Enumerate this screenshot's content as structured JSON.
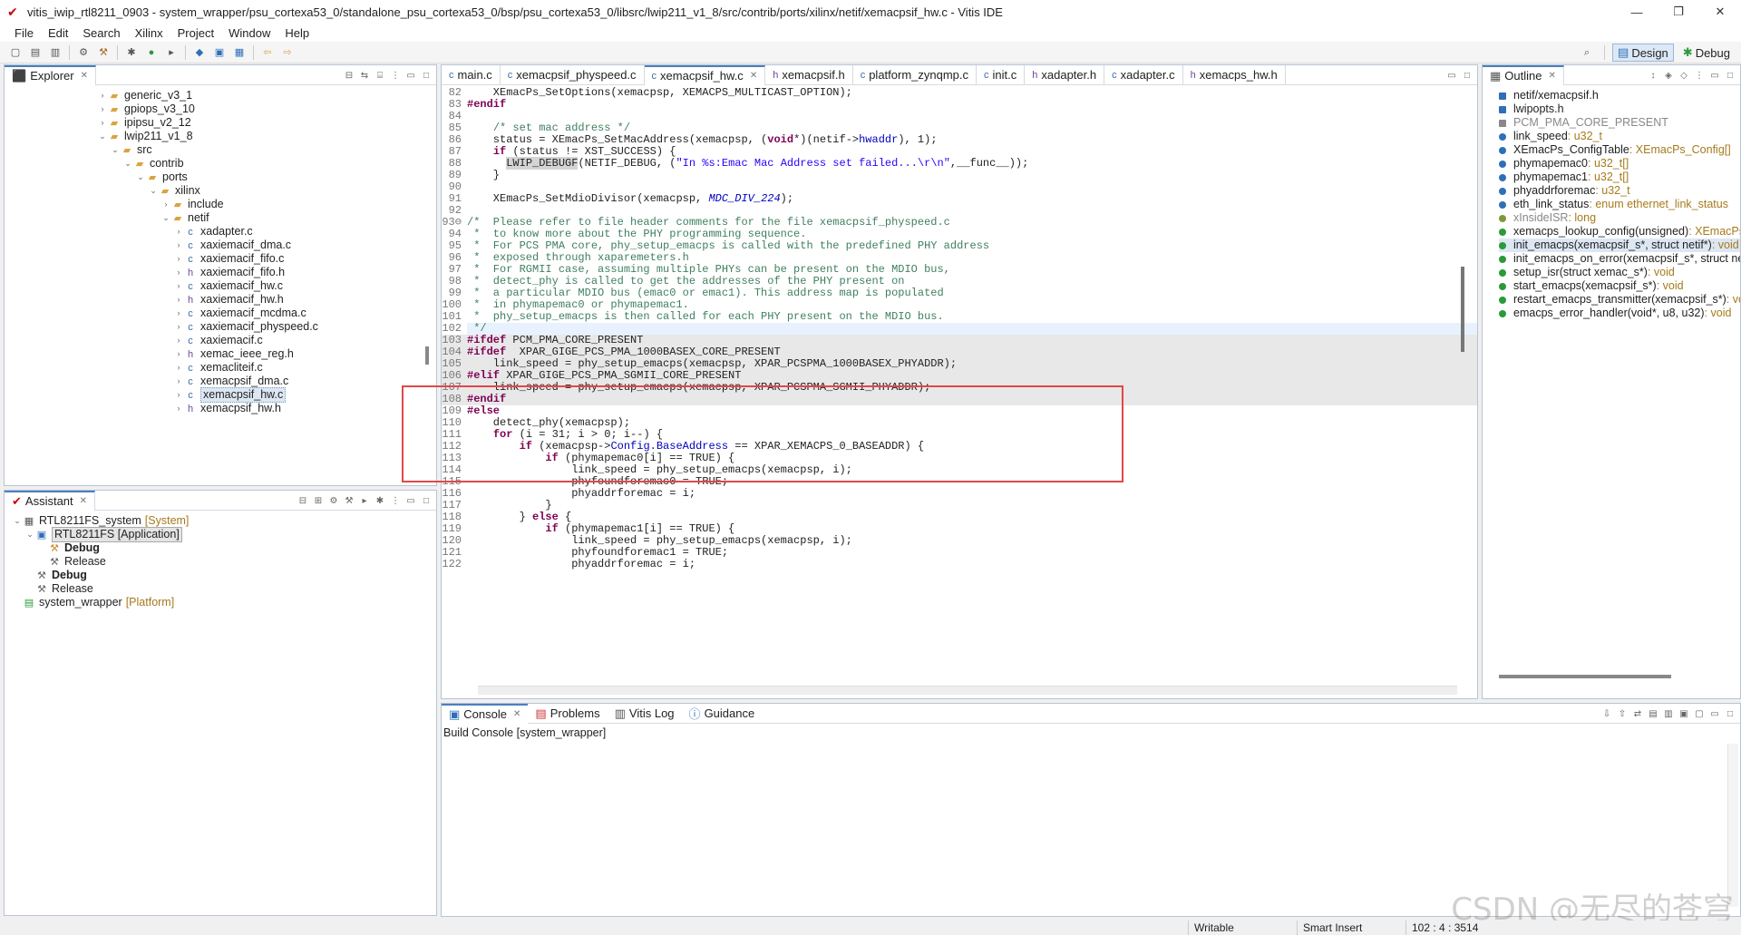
{
  "window": {
    "title": "vitis_iwip_rtl8211_0903 - system_wrapper/psu_cortexa53_0/standalone_psu_cortexa53_0/bsp/psu_cortexa53_0/libsrc/lwip211_v1_8/src/contrib/ports/xilinx/netif/xemacpsif_hw.c - Vitis IDE",
    "minimize": "—",
    "restore": "❐",
    "close": "✕"
  },
  "menu": [
    "File",
    "Edit",
    "Search",
    "Xilinx",
    "Project",
    "Window",
    "Help"
  ],
  "perspectives": {
    "design": "Design",
    "debug": "Debug"
  },
  "explorer": {
    "tab": "Explorer",
    "items": [
      {
        "indent": 0,
        "tw": "›",
        "icon": "folder",
        "label": "generic_v3_1"
      },
      {
        "indent": 0,
        "tw": "›",
        "icon": "folder",
        "label": "gpiops_v3_10"
      },
      {
        "indent": 0,
        "tw": "›",
        "icon": "folder",
        "label": "ipipsu_v2_12"
      },
      {
        "indent": 0,
        "tw": "⌄",
        "icon": "folder",
        "label": "lwip211_v1_8"
      },
      {
        "indent": 1,
        "tw": "⌄",
        "icon": "folder",
        "label": "src"
      },
      {
        "indent": 2,
        "tw": "⌄",
        "icon": "folder",
        "label": "contrib"
      },
      {
        "indent": 3,
        "tw": "⌄",
        "icon": "folder",
        "label": "ports"
      },
      {
        "indent": 4,
        "tw": "⌄",
        "icon": "folder",
        "label": "xilinx"
      },
      {
        "indent": 5,
        "tw": "›",
        "icon": "folder",
        "label": "include"
      },
      {
        "indent": 5,
        "tw": "⌄",
        "icon": "folder",
        "label": "netif"
      },
      {
        "indent": 6,
        "tw": "›",
        "icon": "c",
        "label": "xadapter.c"
      },
      {
        "indent": 6,
        "tw": "›",
        "icon": "c",
        "label": "xaxiemacif_dma.c"
      },
      {
        "indent": 6,
        "tw": "›",
        "icon": "c",
        "label": "xaxiemacif_fifo.c"
      },
      {
        "indent": 6,
        "tw": "›",
        "icon": "h",
        "label": "xaxiemacif_fifo.h"
      },
      {
        "indent": 6,
        "tw": "›",
        "icon": "c",
        "label": "xaxiemacif_hw.c"
      },
      {
        "indent": 6,
        "tw": "›",
        "icon": "h",
        "label": "xaxiemacif_hw.h"
      },
      {
        "indent": 6,
        "tw": "›",
        "icon": "c",
        "label": "xaxiemacif_mcdma.c"
      },
      {
        "indent": 6,
        "tw": "›",
        "icon": "c",
        "label": "xaxiemacif_physpeed.c"
      },
      {
        "indent": 6,
        "tw": "›",
        "icon": "c",
        "label": "xaxiemacif.c"
      },
      {
        "indent": 6,
        "tw": "›",
        "icon": "h",
        "label": "xemac_ieee_reg.h"
      },
      {
        "indent": 6,
        "tw": "›",
        "icon": "c",
        "label": "xemacliteif.c"
      },
      {
        "indent": 6,
        "tw": "›",
        "icon": "c",
        "label": "xemacpsif_dma.c"
      },
      {
        "indent": 6,
        "tw": "›",
        "icon": "c",
        "label": "xemacpsif_hw.c",
        "selected": true
      },
      {
        "indent": 6,
        "tw": "›",
        "icon": "h",
        "label": "xemacpsif_hw.h"
      }
    ]
  },
  "assistant": {
    "tab": "Assistant",
    "items": [
      {
        "indent": 0,
        "tw": "⌄",
        "label": "RTL8211FS_system",
        "tag": "[System]",
        "icon": "sys"
      },
      {
        "indent": 1,
        "tw": "⌄",
        "label": "RTL8211FS [Application]",
        "tag": "",
        "icon": "app",
        "boxed": true
      },
      {
        "indent": 2,
        "tw": "",
        "label": "Debug",
        "tag": "",
        "icon": "hammer",
        "bold": true
      },
      {
        "indent": 2,
        "tw": "",
        "label": "Release",
        "tag": "",
        "icon": "hammer2"
      },
      {
        "indent": 1,
        "tw": "",
        "label": "Debug",
        "tag": "",
        "icon": "hammer2",
        "bold": true
      },
      {
        "indent": 1,
        "tw": "",
        "label": "Release",
        "tag": "",
        "icon": "hammer2"
      },
      {
        "indent": 0,
        "tw": "",
        "label": "system_wrapper",
        "tag": "[Platform]",
        "icon": "plat"
      }
    ]
  },
  "editor": {
    "tabs": [
      {
        "label": "main.c",
        "icon": "c"
      },
      {
        "label": "xemacpsif_physpeed.c",
        "icon": "c"
      },
      {
        "label": "xemacpsif_hw.c",
        "icon": "c",
        "active": true
      },
      {
        "label": "xemacpsif.h",
        "icon": "h"
      },
      {
        "label": "platform_zynqmp.c",
        "icon": "c"
      },
      {
        "label": "init.c",
        "icon": "c"
      },
      {
        "label": "xadapter.h",
        "icon": "h"
      },
      {
        "label": "xadapter.c",
        "icon": "c"
      },
      {
        "label": "xemacps_hw.h",
        "icon": "h"
      }
    ],
    "lines": [
      {
        "n": "82",
        "html": "    XEmacPs_SetOptions(xemacpsp, XEMACPS_MULTICAST_OPTION);"
      },
      {
        "n": "83",
        "html": "<span class=\"kw\">#endif</span>"
      },
      {
        "n": "84",
        "html": ""
      },
      {
        "n": "85",
        "html": "    <span class=\"cm\">/* set mac address */</span>"
      },
      {
        "n": "86",
        "html": "    status = XEmacPs_SetMacAddress(xemacpsp, (<span class=\"kw\">void</span>*)(netif-&gt;<span class=\"fld\">hwaddr</span>), 1);"
      },
      {
        "n": "87",
        "html": "    <span class=\"kw\">if</span> (status != XST_SUCCESS) {"
      },
      {
        "n": "88",
        "html": "      <span class=\"hlbox\">LWIP_DEBUGF</span>(NETIF_DEBUG, (<span class=\"str\">\"In %s:Emac Mac Address set failed...\\r\\n\"</span>,__func__));"
      },
      {
        "n": "89",
        "html": "    }"
      },
      {
        "n": "90",
        "html": ""
      },
      {
        "n": "91",
        "html": "    XEmacPs_SetMdioDivisor(xemacpsp, <span class=\"mac\">MDC_DIV_224</span>);"
      },
      {
        "n": "92",
        "html": ""
      },
      {
        "n": "93⊖",
        "html": "<span class=\"cm\">/*  Please refer to file header comments for the file xemacpsif_physpeed.c</span>"
      },
      {
        "n": "94",
        "html": "<span class=\"cm\"> *  to know more about the PHY programming sequence.</span>"
      },
      {
        "n": "95",
        "html": "<span class=\"cm\"> *  For PCS PMA core, phy_setup_emacps is called with the predefined PHY address</span>"
      },
      {
        "n": "96",
        "html": "<span class=\"cm\"> *  exposed through xaparemeters.h</span>"
      },
      {
        "n": "97",
        "html": "<span class=\"cm\"> *  For RGMII case, assuming multiple PHYs can be present on the MDIO bus,</span>"
      },
      {
        "n": "98",
        "html": "<span class=\"cm\"> *  detect_phy is called to get the addresses of the PHY present on</span>"
      },
      {
        "n": "99",
        "html": "<span class=\"cm\"> *  a particular MDIO bus (emac0 or emac1). This address map is populated</span>"
      },
      {
        "n": "100",
        "html": "<span class=\"cm\"> *  in phymapemac0 or phymapemac1.</span>"
      },
      {
        "n": "101",
        "html": "<span class=\"cm\"> *  phy_setup_emacps is then called for each PHY present on the MDIO bus.</span>"
      },
      {
        "n": "102",
        "html": "<span class=\"cm\"> */</span>",
        "cur": true
      },
      {
        "n": "103",
        "html": "<span class=\"kw\">#ifdef</span> PCM_PMA_CORE_PRESENT",
        "hl": true
      },
      {
        "n": "104",
        "html": "<span class=\"kw\">#ifdef</span>  XPAR_GIGE_PCS_PMA_1000BASEX_CORE_PRESENT",
        "hl": true
      },
      {
        "n": "105",
        "html": "    link_speed = phy_setup_emacps(xemacpsp, XPAR_PCSPMA_1000BASEX_PHYADDR);",
        "hl": true
      },
      {
        "n": "106",
        "html": "<span class=\"kw\">#elif</span> XPAR_GIGE_PCS_PMA_SGMII_CORE_PRESENT",
        "hl": true
      },
      {
        "n": "107",
        "html": "    link_speed = phy_setup_emacps(xemacpsp, XPAR_PCSPMA_SGMII_PHYADDR);",
        "hl": true
      },
      {
        "n": "108",
        "html": "<span class=\"kw\">#endif</span>",
        "hl": true
      },
      {
        "n": "109",
        "html": "<span class=\"kw\">#else</span>"
      },
      {
        "n": "110",
        "html": "    detect_phy(xemacpsp);"
      },
      {
        "n": "111",
        "html": "    <span class=\"kw\">for</span> (i = 31; i &gt; 0; i--) {"
      },
      {
        "n": "112",
        "html": "        <span class=\"kw\">if</span> (xemacpsp-&gt;<span class=\"fld\">Config</span>.<span class=\"fld\">BaseAddress</span> == XPAR_XEMACPS_0_BASEADDR) {"
      },
      {
        "n": "113",
        "html": "            <span class=\"kw\">if</span> (phymapemac0[i] == TRUE) {"
      },
      {
        "n": "114",
        "html": "                link_speed = phy_setup_emacps(xemacpsp, i);"
      },
      {
        "n": "115",
        "html": "                phyfoundforemac0 = TRUE;"
      },
      {
        "n": "116",
        "html": "                phyaddrforemac = i;"
      },
      {
        "n": "117",
        "html": "            }"
      },
      {
        "n": "118",
        "html": "        } <span class=\"kw\">else</span> {"
      },
      {
        "n": "119",
        "html": "            <span class=\"kw\">if</span> (phymapemac1[i] == TRUE) {"
      },
      {
        "n": "120",
        "html": "                link_speed = phy_setup_emacps(xemacpsp, i);"
      },
      {
        "n": "121",
        "html": "                phyfoundforemac1 = TRUE;"
      },
      {
        "n": "122",
        "html": "                phyaddrforemac = i;"
      }
    ]
  },
  "outline": {
    "tab": "Outline",
    "items": [
      {
        "icon": "inc",
        "label": "netif/xemacpsif.h",
        "type": ""
      },
      {
        "icon": "inc",
        "label": "lwipopts.h",
        "type": ""
      },
      {
        "icon": "macro",
        "label": "PCM_PMA_CORE_PRESENT",
        "type": "",
        "muted": true
      },
      {
        "icon": "var",
        "label": "link_speed",
        "type": " : u32_t"
      },
      {
        "icon": "var",
        "label": "XEmacPs_ConfigTable",
        "type": " : XEmacPs_Config[]"
      },
      {
        "icon": "var",
        "label": "phymapemac0",
        "type": " : u32_t[]"
      },
      {
        "icon": "var",
        "label": "phymapemac1",
        "type": " : u32_t[]"
      },
      {
        "icon": "var",
        "label": "phyaddrforemac",
        "type": " : u32_t"
      },
      {
        "icon": "var",
        "label": "eth_link_status",
        "type": " : enum ethernet_link_status"
      },
      {
        "icon": "static",
        "label": "xInsideISR",
        "type": " : long",
        "muted": true
      },
      {
        "icon": "fn",
        "label": "xemacps_lookup_config(unsigned)",
        "type": " : XEmacPs_Config*"
      },
      {
        "icon": "fn",
        "label": "init_emacps(xemacpsif_s*, struct netif*)",
        "type": " : void",
        "selected": true
      },
      {
        "icon": "fn",
        "label": "init_emacps_on_error(xemacpsif_s*, struct netif*)",
        "type": " : void"
      },
      {
        "icon": "fn",
        "label": "setup_isr(struct xemac_s*)",
        "type": " : void"
      },
      {
        "icon": "fn",
        "label": "start_emacps(xemacpsif_s*)",
        "type": " : void"
      },
      {
        "icon": "fn",
        "label": "restart_emacps_transmitter(xemacpsif_s*)",
        "type": " : void"
      },
      {
        "icon": "fn",
        "label": "emacps_error_handler(void*, u8, u32)",
        "type": " : void"
      }
    ]
  },
  "console": {
    "tabs": [
      {
        "label": "Console",
        "icon": "console",
        "active": true
      },
      {
        "label": "Problems",
        "icon": "problems"
      },
      {
        "label": "Vitis Log",
        "icon": "log"
      },
      {
        "label": "Guidance",
        "icon": "info"
      }
    ],
    "header": "Build Console [system_wrapper]"
  },
  "status": {
    "writable": "Writable",
    "insert_mode": "Smart Insert",
    "position": "102 : 4 : 3514"
  },
  "watermark": "CSDN @无尽的苍穹",
  "colors": {
    "accent": "#4a7fc1",
    "highlight_box": "#e0484a"
  }
}
